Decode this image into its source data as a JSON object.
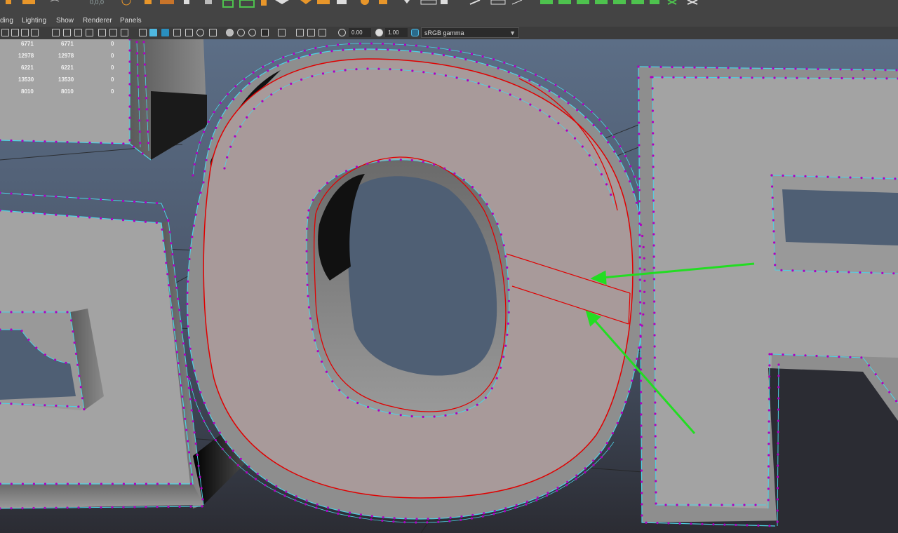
{
  "menubar": {
    "items": [
      "ding",
      "Lighting",
      "Show",
      "Renderer",
      "Panels"
    ]
  },
  "toolbar": {
    "exposure_value": "0.00",
    "gamma_value": "1.00",
    "color_space": "sRGB gamma",
    "top_text": "0,0,0"
  },
  "hud": {
    "rows": [
      {
        "a": "6771",
        "b": "6771",
        "c": "0"
      },
      {
        "a": "12978",
        "b": "12978",
        "c": "0"
      },
      {
        "a": "6221",
        "b": "6221",
        "c": "0"
      },
      {
        "a": "13530",
        "b": "13530",
        "c": "0"
      },
      {
        "a": "8010",
        "b": "8010",
        "c": "0"
      }
    ]
  },
  "colors": {
    "viewport_top": "#5c6e86",
    "viewport_bottom": "#2b2c33",
    "face": "#a3a3a3",
    "selected_face": "#a89a9a",
    "wire": "#4fd1e6",
    "vertex": "#b000c0",
    "selection_edge": "#e00000",
    "annotation_arrow": "#22dd22",
    "accent_orange": "#e8962a",
    "accent_green": "#4ec24e"
  }
}
